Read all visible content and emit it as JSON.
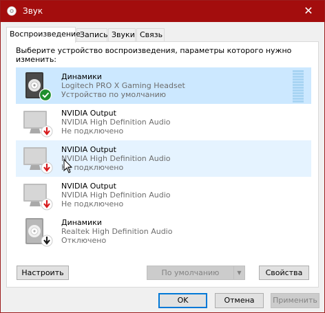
{
  "window": {
    "title": "Звук",
    "close_glyph": "✕"
  },
  "tabs": [
    {
      "label": "Воспроизведение",
      "active": true
    },
    {
      "label": "Запись",
      "active": false
    },
    {
      "label": "Звуки",
      "active": false
    },
    {
      "label": "Связь",
      "active": false
    }
  ],
  "prompt": "Выберите устройство воспроизведения, параметры которого нужно изменить:",
  "devices": [
    {
      "name": "Динамики",
      "description": "Logitech PRO X Gaming Headset",
      "status": "Устройство по умолчанию",
      "icon": "speaker-icon",
      "badge": "default-check-icon",
      "selected": true,
      "level_shown": 0
    },
    {
      "name": "NVIDIA Output",
      "description": "NVIDIA High Definition Audio",
      "status": "Не подключено",
      "icon": "monitor-icon",
      "badge": "unplugged-arrow-icon",
      "selected": false
    },
    {
      "name": "NVIDIA Output",
      "description": "NVIDIA High Definition Audio",
      "status": "Не подключено",
      "icon": "monitor-icon",
      "badge": "unplugged-arrow-icon",
      "selected": false,
      "hovered": true
    },
    {
      "name": "NVIDIA Output",
      "description": "NVIDIA High Definition Audio",
      "status": "Не подключено",
      "icon": "monitor-icon",
      "badge": "unplugged-arrow-icon",
      "selected": false
    },
    {
      "name": "Динамики",
      "description": "Realtek High Definition Audio",
      "status": "Отключено",
      "icon": "speaker-icon",
      "badge": "disabled-arrow-icon",
      "selected": false
    }
  ],
  "buttons": {
    "configure": "Настроить",
    "set_default": "По умолчанию",
    "properties": "Свойства",
    "ok": "OK",
    "cancel": "Отмена",
    "apply": "Применить"
  },
  "colors": {
    "titlebar": "#a30d0d",
    "selection": "#cce8ff",
    "hover": "#e5f3ff",
    "accent": "#0078d7",
    "check_green": "#1e8f2e",
    "arrow_red": "#d7191c"
  }
}
